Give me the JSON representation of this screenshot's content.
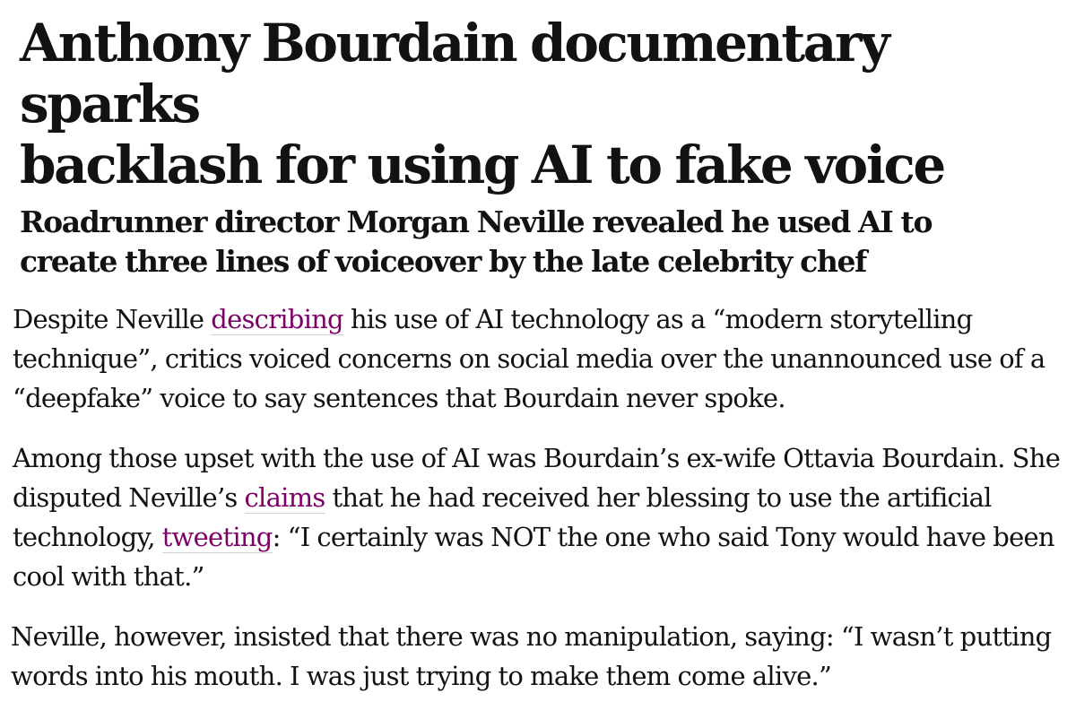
{
  "article": {
    "headline_line1": "Anthony Bourdain documentary sparks",
    "headline_line2": "backlash for using AI to fake voice",
    "standfirst_line1": "Roadrunner director Morgan Neville revealed he used AI to",
    "standfirst_line2": "create three lines of voiceover by the late celebrity chef",
    "p1": {
      "before": "Despite Neville ",
      "link": "describing",
      "after": " his use of AI technology as a “modern storytelling technique”, critics voiced concerns on social media over the unannounced use of a “deepfake” voice to say sentences that Bourdain never spoke."
    },
    "p2": {
      "before": "Among those upset with the use of AI was Bourdain’s ex-wife Ottavia Bourdain. She disputed Neville’s ",
      "link1": "claims",
      "middle": " that he had received her blessing to use the artificial technology, ",
      "link2": "tweeting",
      "after": ": “I certainly was NOT the one who said Tony would have been cool with that.”"
    },
    "p3": {
      "text": "Neville, however, insisted that there was no manipulation, saying: “I wasn’t putting words into his mouth. I was just trying to make them come alive.”"
    }
  },
  "colors": {
    "text": "#121212",
    "link": "#7d0068",
    "background": "#ffffff"
  }
}
